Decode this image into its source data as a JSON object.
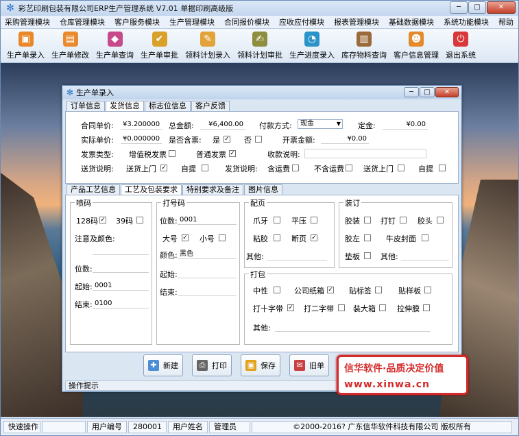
{
  "app": {
    "title": "彩艺印刷包装有限公司ERP生产管理系统  V7.01 单据印刷高级版",
    "window_buttons": {
      "minimize": "─",
      "maximize": "□",
      "close": "✕"
    }
  },
  "menu": [
    "采购管理模块",
    "仓库管理模块",
    "客户服务模块",
    "生产管理模块",
    "合同报价模块",
    "应收应付模块",
    "报表管理模块",
    "基础数据模块",
    "系统功能模块",
    "帮助"
  ],
  "toolbar": [
    {
      "label": "生产单录入",
      "icon": "box-icon",
      "color": "#e9872b"
    },
    {
      "label": "生产单修改",
      "icon": "edit-box-icon",
      "color": "#e98a2d"
    },
    {
      "label": "生产单查询",
      "icon": "query-icon",
      "color": "#c74a8a"
    },
    {
      "label": "生产单审批",
      "icon": "approve-icon",
      "color": "#d9a12a"
    },
    {
      "label": "领料计划录入",
      "icon": "material-icon",
      "color": "#e1a33a"
    },
    {
      "label": "领料计划审批",
      "icon": "material-approve-icon",
      "color": "#8e8e3e"
    },
    {
      "label": "生产进度录入",
      "icon": "progress-icon",
      "color": "#2c93c9"
    },
    {
      "label": "库存物料查询",
      "icon": "inventory-icon",
      "color": "#9b6a3a"
    },
    {
      "label": "客户信息管理",
      "icon": "customer-icon",
      "color": "#e58a2a"
    },
    {
      "label": "退出系统",
      "icon": "exit-icon",
      "color": "#d9383a"
    }
  ],
  "dialog": {
    "title": "生产单录入",
    "tabs": [
      "订单信息",
      "发货信息",
      "标志位信息",
      "客户反馈"
    ],
    "active_tab": "发货信息",
    "fields": {
      "contract_price_label": "合同单价:",
      "contract_price": "¥3.200000",
      "total_amount_label": "总金额:",
      "total_amount": "¥6,400.00",
      "payment_method_label": "付款方式:",
      "payment_method": "现金",
      "deposit_label": "定金:",
      "deposit": "¥0.00",
      "actual_price_label": "实际单价:",
      "actual_price": "¥0.000000",
      "tax_label": "是否含票:",
      "tax_yes": "是",
      "tax_no": "否",
      "invoice_amount_label": "开票金额:",
      "invoice_amount": "¥0.00",
      "invoice_type_label": "发票类型:",
      "vat_invoice": "增值税发票",
      "normal_invoice": "普通发票",
      "payment_note_label": "收款说明:",
      "delivery_note_label": "送货说明:",
      "deliver_door": "送货上门",
      "self_pick": "自提",
      "shipping_note_label": "发货说明:",
      "incl_freight": "含运费",
      "excl_freight": "不含运费",
      "ship_door": "送货上门",
      "ship_self": "自提"
    },
    "subtabs": [
      "产品工艺信息",
      "工艺及包装要求",
      "特别要求及备注",
      "图片信息"
    ],
    "active_subtab": "工艺及包装要求",
    "spray_code": {
      "title": "喷码",
      "code128": "128码",
      "code39": "39码",
      "note_label": "注意及颜色:",
      "digits_label": "位数:",
      "digits": "",
      "start_label": "起始:",
      "start": "0001",
      "end_label": "结束:",
      "end": "0100"
    },
    "number_code": {
      "title": "打号码",
      "digits_label": "位数:",
      "digits": "0001",
      "big": "大号",
      "small": "小号",
      "color_label": "颜色:",
      "color": "黑色",
      "start_label": "起始:",
      "end_label": "结束:"
    },
    "collate": {
      "title": "配页",
      "claw": "爪牙",
      "flat": "平压",
      "glue": "粘胶",
      "break": "断页",
      "other_label": "其他:"
    },
    "binding": {
      "title": "装订",
      "glue_bind": "胶装",
      "staple": "打钉",
      "glue_head": "胶头",
      "glue_left": "胶左",
      "kraft_cover": "牛皮封面",
      "pad": "垫板",
      "other_label": "其他:"
    },
    "packing": {
      "title": "打包",
      "neutral": "中性",
      "company_box": "公司纸箱",
      "label": "贴标签",
      "sample": "贴样板",
      "cross": "打十字带",
      "two_band": "打二字带",
      "big_box": "装大箱",
      "film": "拉伸膜",
      "other_label": "其他:"
    },
    "buttons": [
      {
        "label": "新建",
        "icon": "new-doc-icon",
        "color": "#4c8dd6"
      },
      {
        "label": "打印",
        "icon": "printer-icon",
        "color": "#666666"
      },
      {
        "label": "保存",
        "icon": "save-icon",
        "color": "#e2a21c"
      },
      {
        "label": "旧单",
        "icon": "old-order-icon",
        "color": "#c94040"
      }
    ],
    "status_label": "操作提示"
  },
  "ad": {
    "line1": "信华软件·品质决定价值",
    "line2": "www.xinwa.cn"
  },
  "statusbar": {
    "quick_op": "快速操作",
    "user_id_label": "用户编号",
    "user_id": "280001",
    "user_name_label": "用户姓名",
    "user_name": "管理员",
    "copyright": "©2000-2016?   广东信华软件科技有限公司   版权所有"
  }
}
